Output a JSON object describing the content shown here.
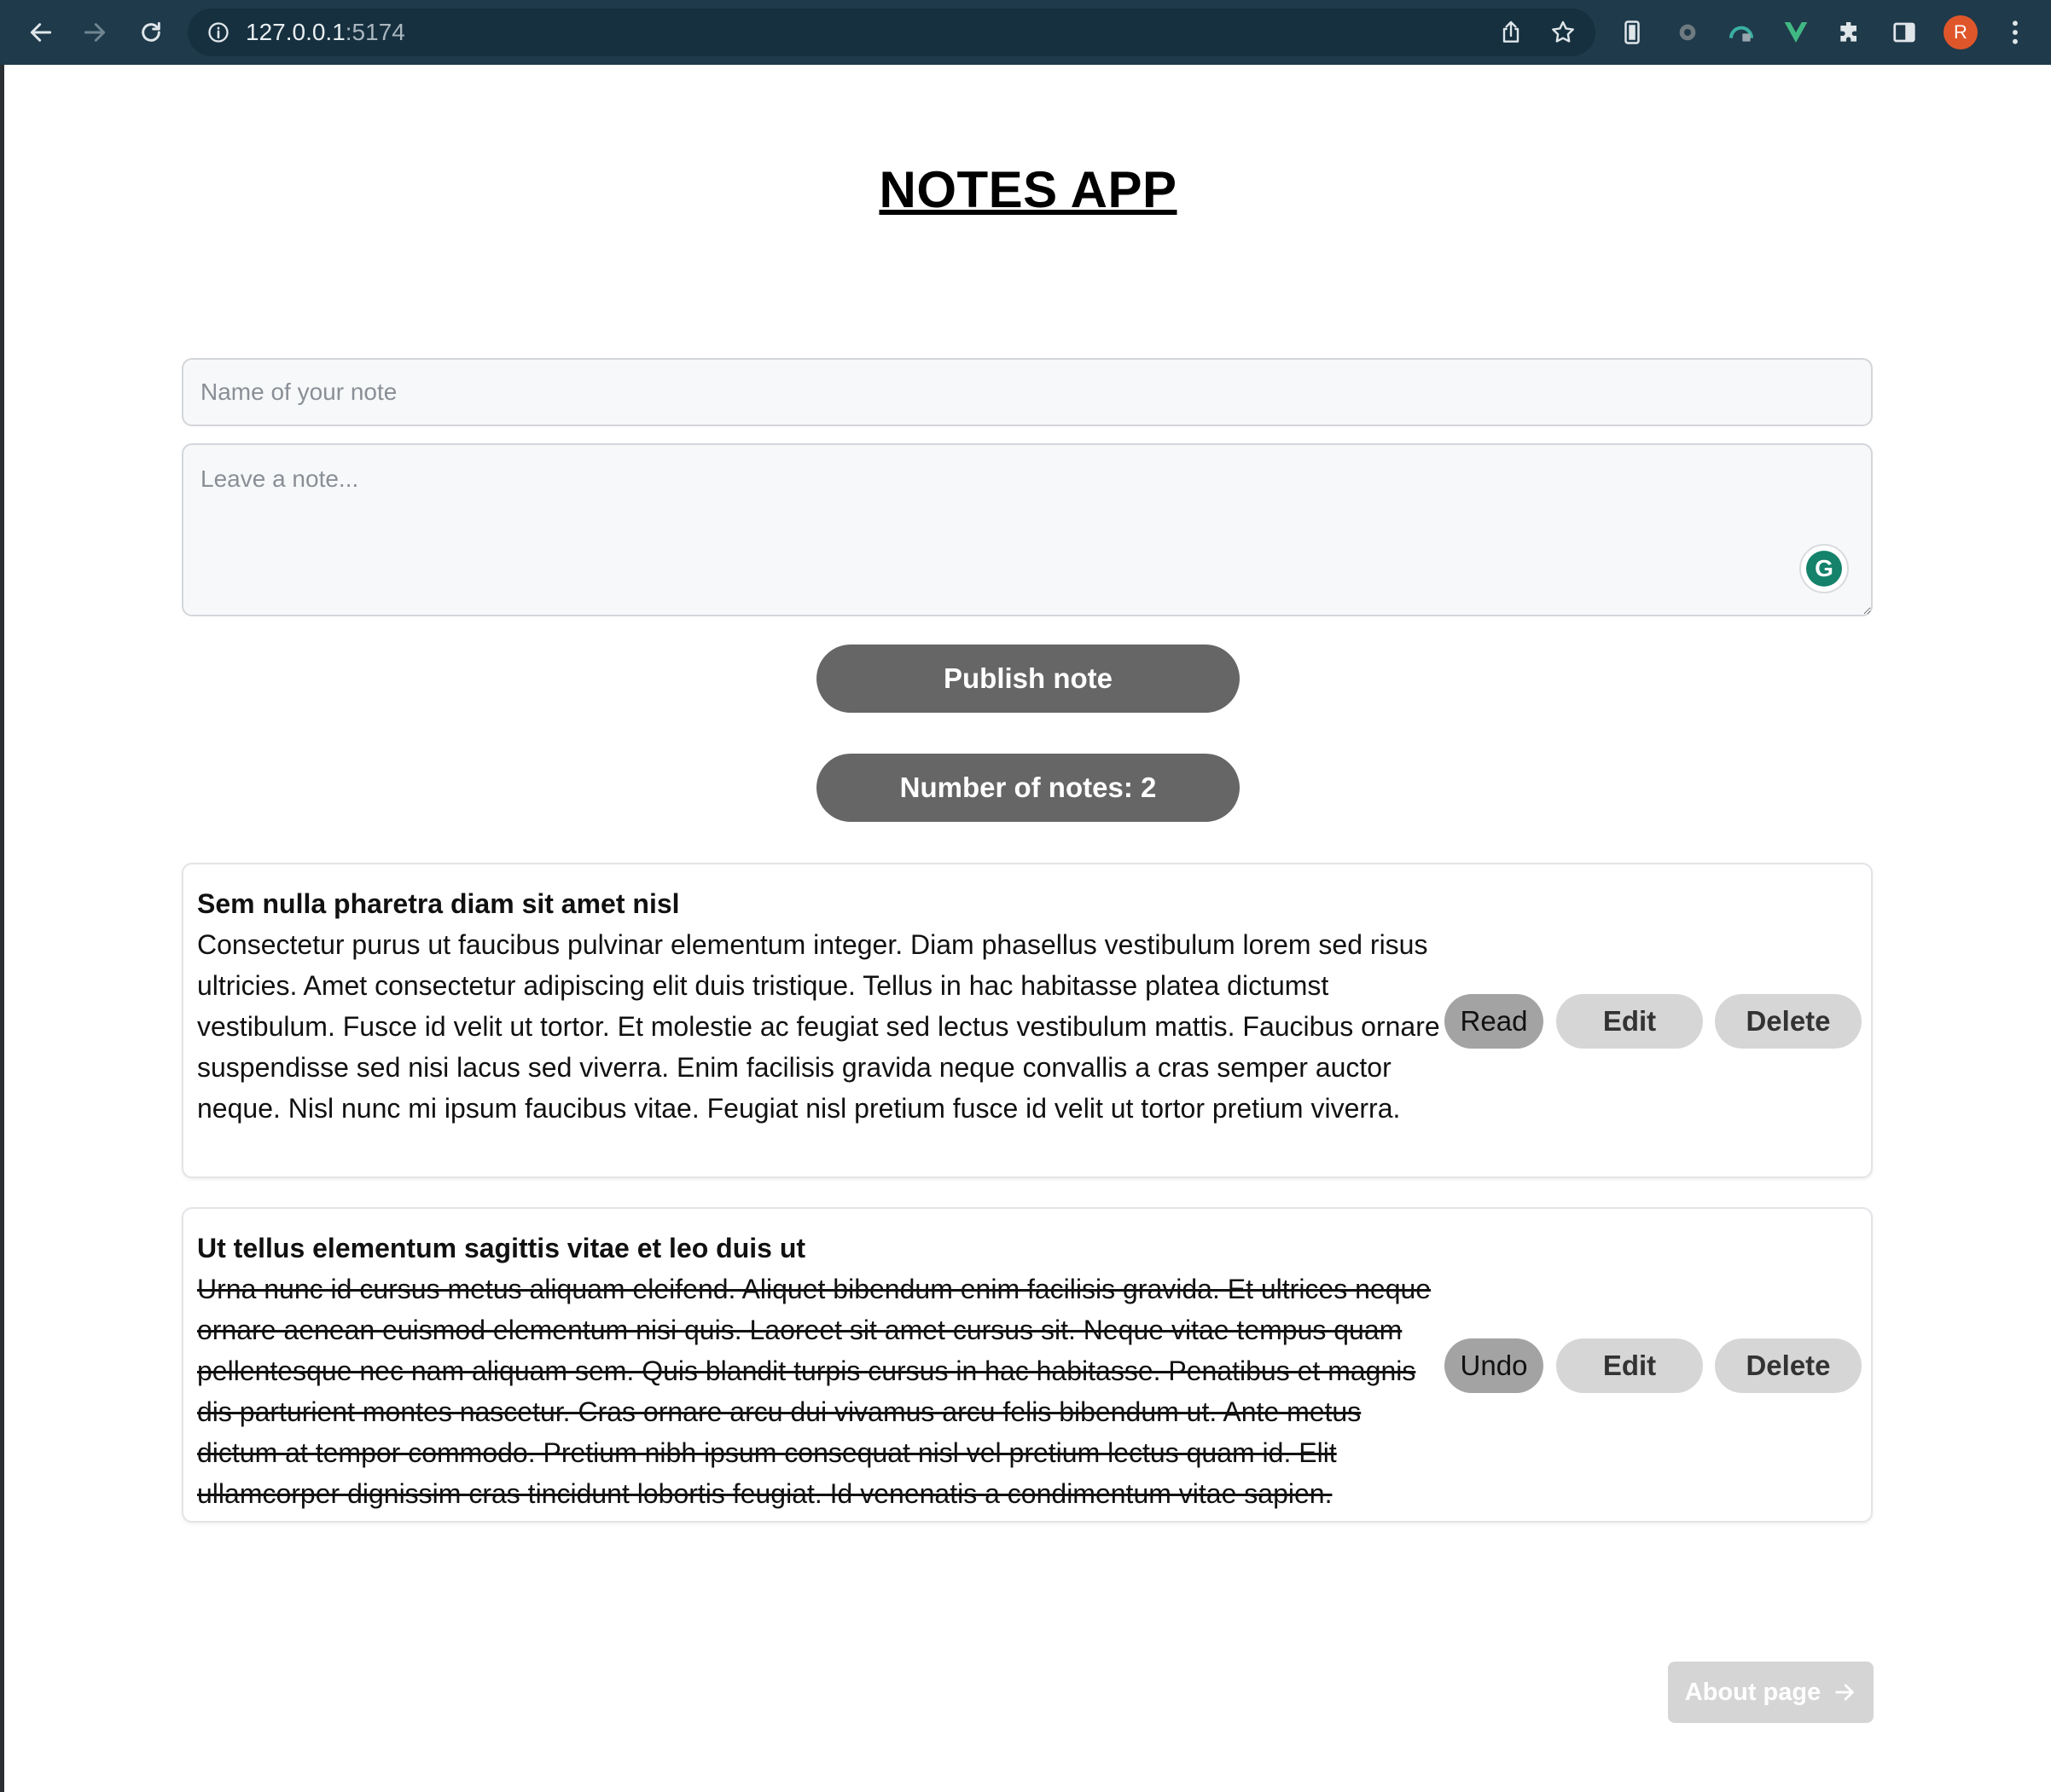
{
  "browser": {
    "url_host": "127.0.0.1",
    "url_port": ":5174",
    "profile_initial": "R",
    "icons": [
      "back-icon",
      "forward-icon",
      "reload-icon",
      "info-icon",
      "share-icon",
      "star-icon",
      "extension-icons",
      "menu-icon"
    ]
  },
  "app": {
    "title": "NOTES APP",
    "name_placeholder": "Name of your note",
    "note_placeholder": "Leave a note...",
    "grammarly_letter": "G",
    "publish_label": "Publish note",
    "count_label": "Number of notes: 2"
  },
  "notes": [
    {
      "title": "Sem nulla pharetra diam sit amet nisl",
      "text": "Consectetur purus ut faucibus pulvinar elementum integer. Diam phasellus vestibulum lorem sed risus ultricies. Amet consectetur adipiscing elit duis tristique. Tellus in hac habitasse platea dictumst vestibulum. Fusce id velit ut tortor. Et molestie ac feugiat sed lectus vestibulum mattis. Faucibus ornare suspendisse sed nisi lacus sed viverra. Enim facilisis gravida neque convallis a cras semper auctor neque. Nisl nunc mi ipsum faucibus vitae. Feugiat nisl pretium fusce id velit ut tortor pretium viverra.",
      "toggle_label": "Read",
      "edit_label": "Edit",
      "delete_label": "Delete"
    },
    {
      "title": "Ut tellus elementum sagittis vitae et leo duis ut",
      "text": "Urna nunc id cursus metus aliquam eleifend. Aliquet bibendum enim facilisis gravida. Et ultrices neque ornare aenean euismod elementum nisi quis. Laoreet sit amet cursus sit. Neque vitae tempus quam pellentesque nec nam aliquam sem. Quis blandit turpis cursus in hac habitasse. Penatibus et magnis dis parturient montes nascetur. Cras ornare arcu dui vivamus arcu felis bibendum ut. Ante metus dictum at tempor commodo. Pretium nibh ipsum consequat nisl vel pretium lectus quam id. Elit ullamcorper dignissim cras tincidunt lobortis feugiat. Id venenatis a condimentum vitae sapien.",
      "toggle_label": "Undo",
      "edit_label": "Edit",
      "delete_label": "Delete"
    }
  ],
  "footer": {
    "about_label": "About page"
  }
}
